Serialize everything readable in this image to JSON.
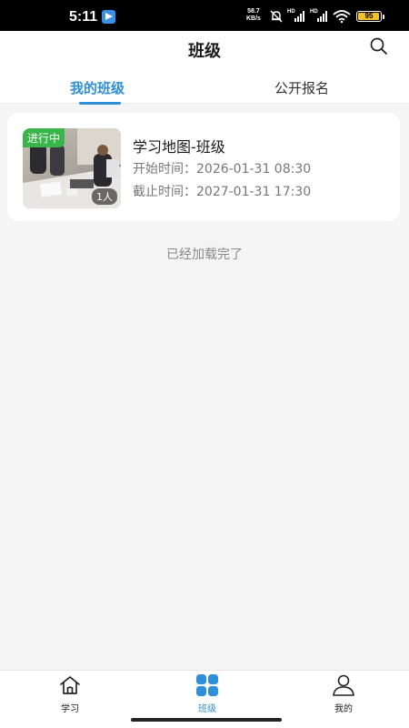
{
  "status_bar": {
    "time": "5:11",
    "net_speed_value": "58.7",
    "net_speed_unit": "KB/s",
    "signal1_label": "HD",
    "signal2_label": "HD",
    "battery_level": "95",
    "battery_color": "#f2c027"
  },
  "header": {
    "title": "班级",
    "search_icon": "search-icon"
  },
  "tabs": [
    {
      "label": "我的班级",
      "active": true
    },
    {
      "label": "公开报名",
      "active": false
    }
  ],
  "classes": [
    {
      "status": "进行中",
      "status_color": "#3ab54a",
      "member_count": "1人",
      "title": "学习地图-班级",
      "start": "开始时间：2026-01-31 08:30",
      "end": "截止时间：2027-01-31 17:30"
    }
  ],
  "list_footer": "已经加载完了",
  "bottom_nav": [
    {
      "label": "学习",
      "icon": "home-icon",
      "active": false
    },
    {
      "label": "班级",
      "icon": "grid-icon",
      "active": true
    },
    {
      "label": "我的",
      "icon": "user-icon",
      "active": false
    }
  ],
  "colors": {
    "accent": "#2f8fd8",
    "background": "#f5f5f5"
  }
}
